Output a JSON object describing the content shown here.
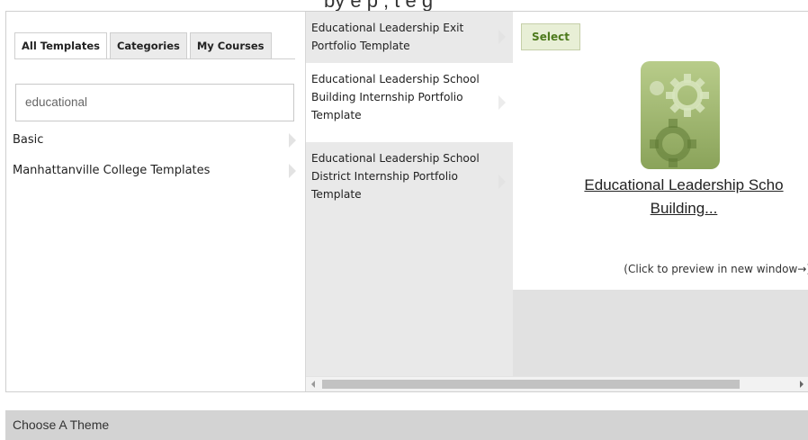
{
  "top_cutoff_text": "by                    e              p   , t   e   g",
  "tabs": [
    {
      "label": "All Templates",
      "active": true
    },
    {
      "label": "Categories",
      "active": false
    },
    {
      "label": "My Courses",
      "active": false
    }
  ],
  "search": {
    "value": "educational"
  },
  "left_items": [
    {
      "label": "Basic"
    },
    {
      "label": "Manhattanville College Templates"
    }
  ],
  "mid_items": [
    {
      "label": "Educational Leadership Exit Portfolio Template",
      "selected": false
    },
    {
      "label": "Educational Leadership School Building Internship Portfolio Template",
      "selected": true
    },
    {
      "label": "Educational Leadership School District Internship Portfolio Template",
      "selected": false
    }
  ],
  "preview": {
    "select_label": "Select",
    "title_line1": "Educational Leadership Scho",
    "title_line2": "Building...",
    "hint": "(Click to preview in new window→)",
    "thumb_icon": "gears-icon"
  },
  "theme_bar": {
    "label": "Choose A Theme"
  },
  "colors": {
    "select_text": "#4d7a1c",
    "select_bg": "#e8efd6",
    "thumb_green": "#9bb26b",
    "panel_gray": "#e9e9e9"
  }
}
